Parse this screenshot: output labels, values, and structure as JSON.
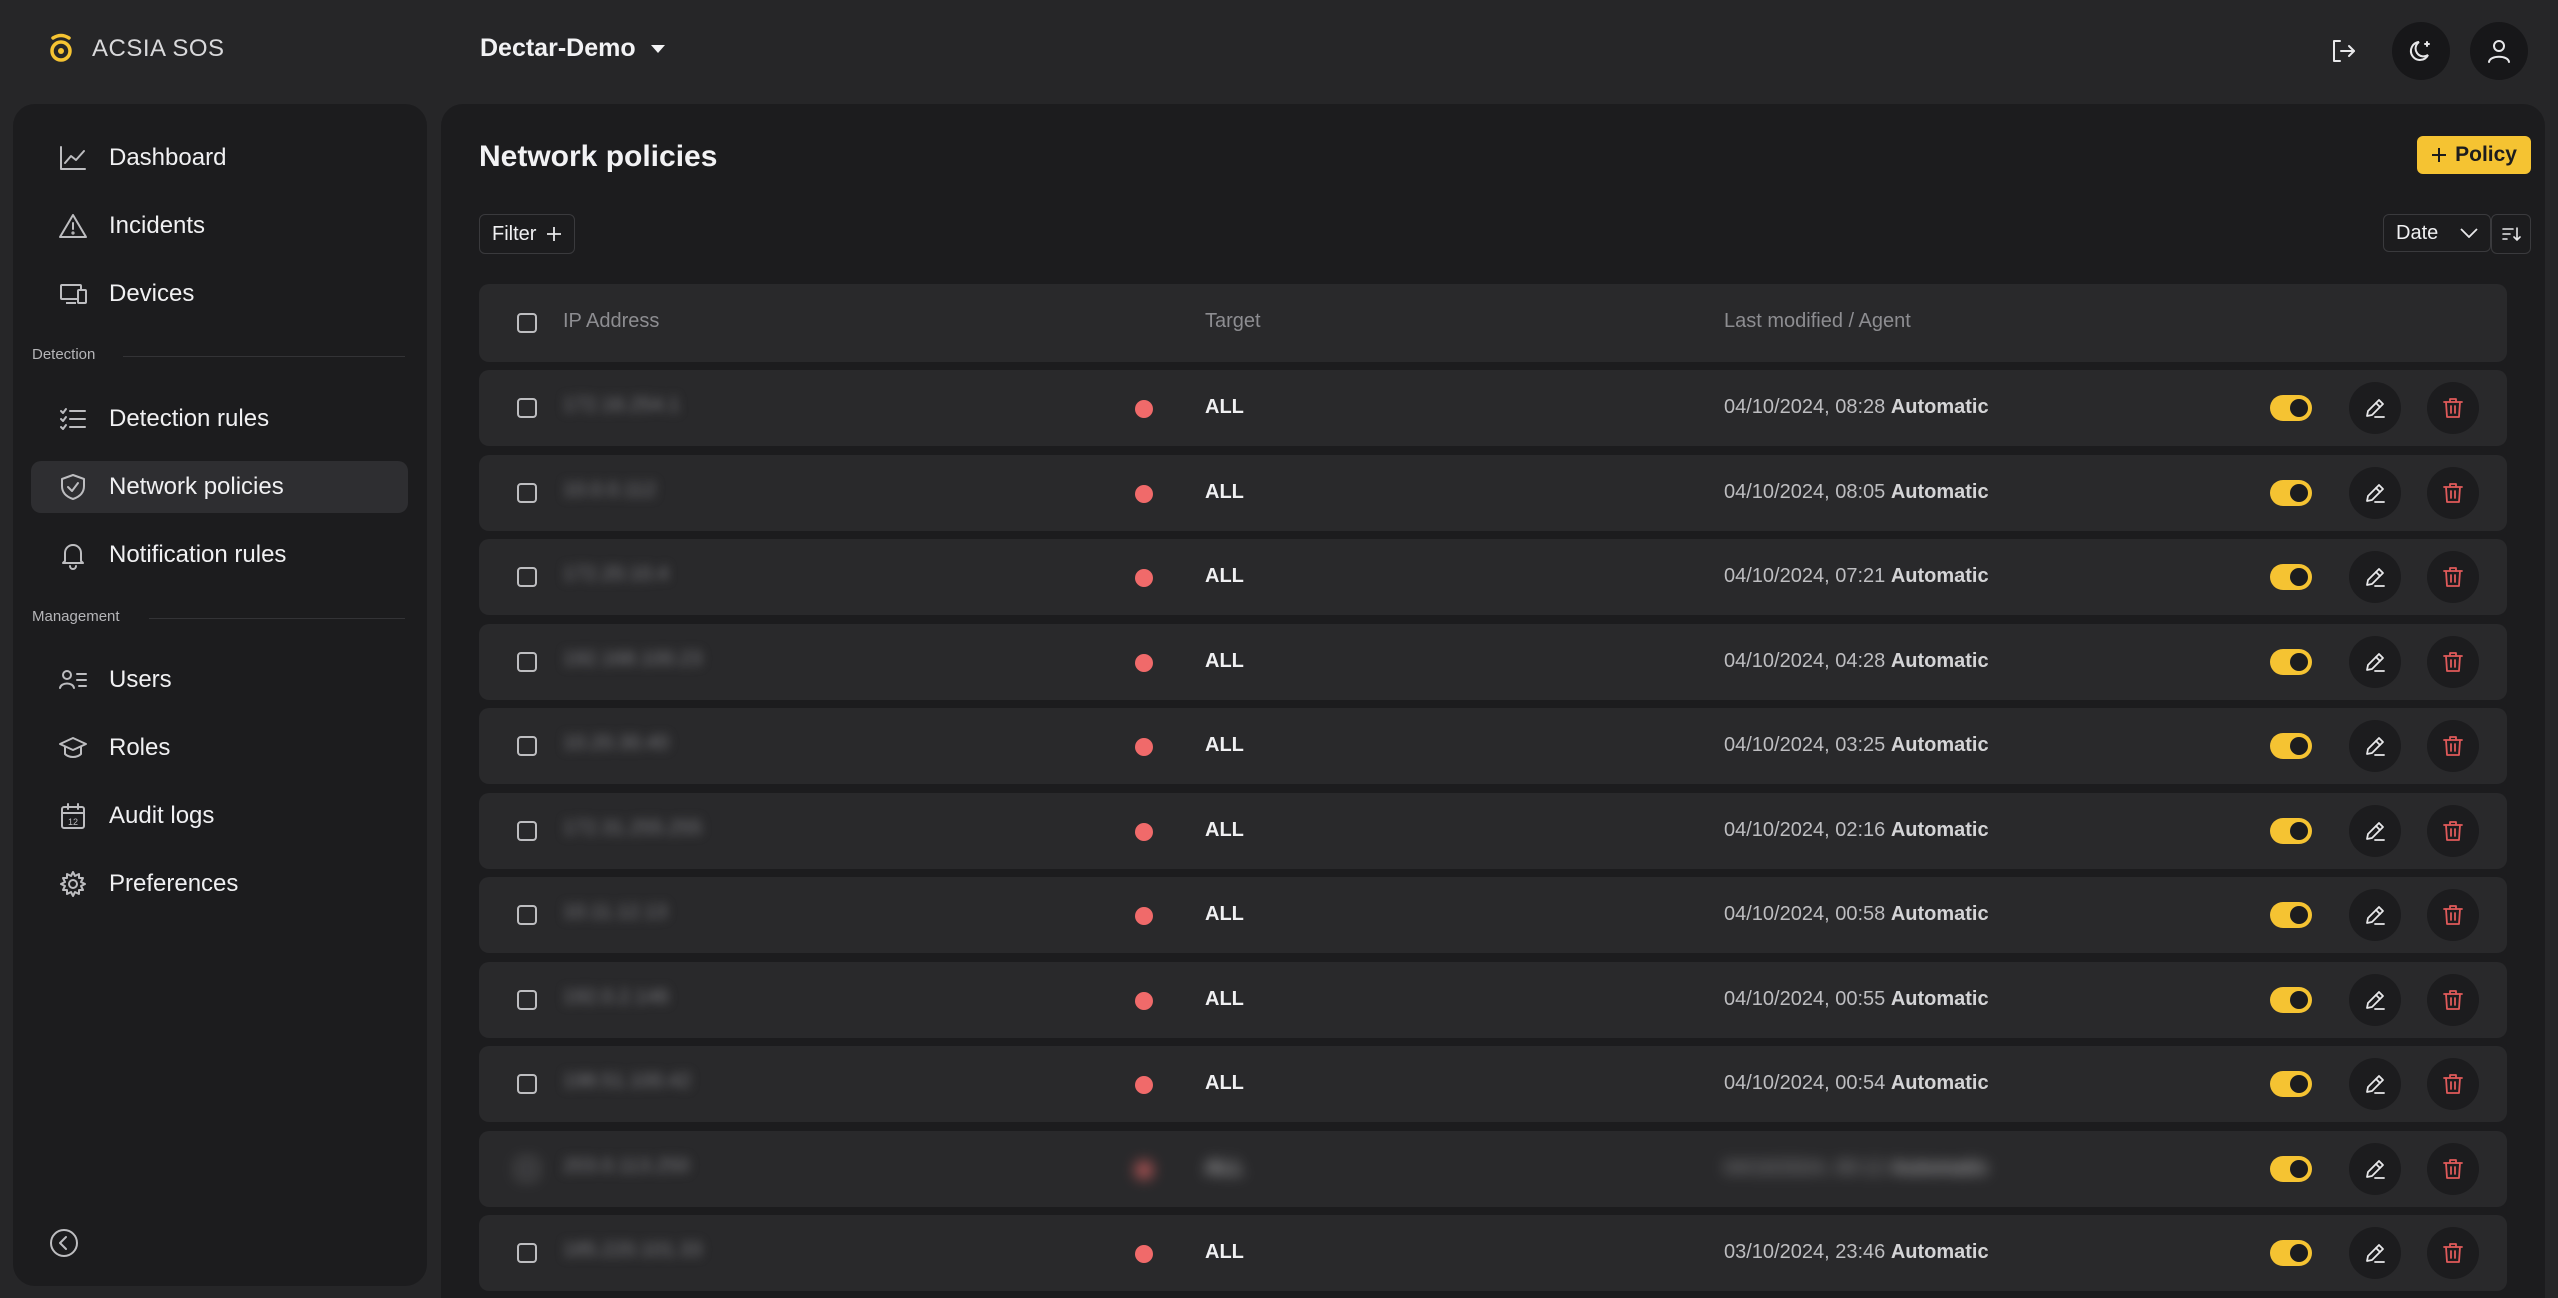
{
  "app": {
    "name": "ACSIA SOS"
  },
  "org": {
    "name": "Dectar-Demo"
  },
  "colors": {
    "accent": "#f5c332",
    "status_red": "#f06a6a",
    "danger": "#e05a5a"
  },
  "sidebar": {
    "items": [
      {
        "label": "Dashboard",
        "icon": "chart-line-icon"
      },
      {
        "label": "Incidents",
        "icon": "warning-icon"
      },
      {
        "label": "Devices",
        "icon": "devices-icon"
      },
      {
        "label": "Detection rules",
        "icon": "list-check-icon"
      },
      {
        "label": "Network policies",
        "icon": "shield-check-icon",
        "active": true
      },
      {
        "label": "Notification rules",
        "icon": "bell-icon"
      },
      {
        "label": "Users",
        "icon": "users-list-icon"
      },
      {
        "label": "Roles",
        "icon": "graduation-cap-icon"
      },
      {
        "label": "Audit logs",
        "icon": "calendar-icon"
      },
      {
        "label": "Preferences",
        "icon": "gear-icon"
      }
    ],
    "sections": {
      "detection": "Detection",
      "management": "Management"
    }
  },
  "main": {
    "title": "Network policies",
    "add_button": "Policy",
    "filter_label": "Filter",
    "sort": {
      "selected": "Date"
    },
    "columns": {
      "ip": "IP Address",
      "target": "Target",
      "modified": "Last modified / Agent"
    },
    "rows": [
      {
        "ip": "172.16.254.1",
        "target": "ALL",
        "date": "04/10/2024, 08:28",
        "agent": "Automatic"
      },
      {
        "ip": "10.0.0.112",
        "target": "ALL",
        "date": "04/10/2024, 08:05",
        "agent": "Automatic"
      },
      {
        "ip": "172.20.10.4",
        "target": "ALL",
        "date": "04/10/2024, 07:21",
        "agent": "Automatic"
      },
      {
        "ip": "192.168.100.23",
        "target": "ALL",
        "date": "04/10/2024, 04:28",
        "agent": "Automatic"
      },
      {
        "ip": "10.20.30.40",
        "target": "ALL",
        "date": "04/10/2024, 03:25",
        "agent": "Automatic"
      },
      {
        "ip": "172.31.255.255",
        "target": "ALL",
        "date": "04/10/2024, 02:16",
        "agent": "Automatic"
      },
      {
        "ip": "10.11.12.13",
        "target": "ALL",
        "date": "04/10/2024, 00:58",
        "agent": "Automatic"
      },
      {
        "ip": "192.0.2.146",
        "target": "ALL",
        "date": "04/10/2024, 00:55",
        "agent": "Automatic"
      },
      {
        "ip": "198.51.100.42",
        "target": "ALL",
        "date": "04/10/2024, 00:54",
        "agent": "Automatic"
      },
      {
        "ip": "203.0.113.250",
        "target": "ALL",
        "date": "04/10/2024, 00:12",
        "agent": "Automatic",
        "blurred": true
      },
      {
        "ip": "185.220.101.33",
        "target": "ALL",
        "date": "03/10/2024, 23:46",
        "agent": "Automatic"
      }
    ]
  }
}
